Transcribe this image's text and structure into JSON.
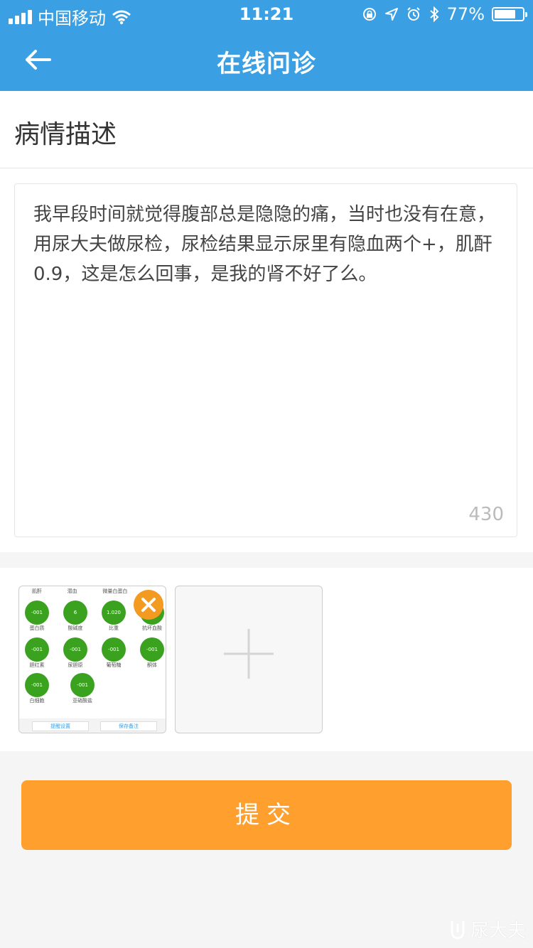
{
  "status_bar": {
    "carrier": "中国移动",
    "time": "11:21",
    "battery_percent": "77%",
    "battery_level": 0.77
  },
  "nav": {
    "title": "在线问诊",
    "back_icon": "arrow-left-icon"
  },
  "section": {
    "title": "病情描述"
  },
  "description": {
    "text": "我早段时间就觉得腹部总是隐隐的痛，当时也没有在意，用尿大夫做尿检，尿检结果显示尿里有隐血两个+，肌酐0.9，这是怎么回事，是我的肾不好了么。",
    "remaining_count": "430"
  },
  "attachments": {
    "thumb": {
      "row1_labels": [
        "肌酐",
        "潜血",
        "微量白蛋白"
      ],
      "row2_values": [
        "-001",
        "6",
        "1.020"
      ],
      "row2_labels": [
        "蛋白质",
        "酸碱度",
        "比重",
        "抗坏血酸"
      ],
      "row3_values": [
        "-001",
        "-001",
        "-001",
        "-001"
      ],
      "row3_labels": [
        "胆红素",
        "尿胆原",
        "葡萄糖",
        "酮体"
      ],
      "row4_values": [
        "-001",
        "-001"
      ],
      "row4_labels": [
        "白细胞",
        "亚硝酸盐"
      ],
      "bottom_buttons": [
        "提醒设置",
        "保存备注"
      ]
    },
    "remove_icon": "close-icon",
    "add_icon": "plus-icon"
  },
  "submit": {
    "label": "提交"
  },
  "watermark": {
    "text": "尿大夫"
  },
  "colors": {
    "nav_bg": "#3aa0e3",
    "submit_bg": "#ff9f2d",
    "remove_bg": "#f39a21",
    "page_bg": "#f5f5f5"
  }
}
